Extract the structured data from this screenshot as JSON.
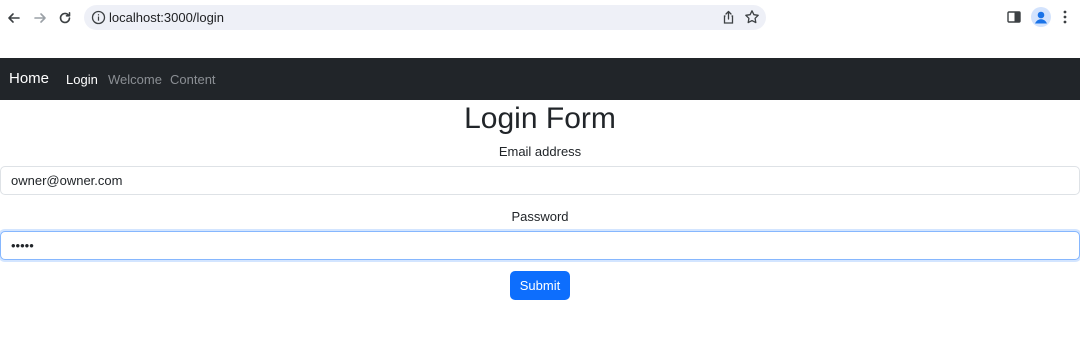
{
  "browser": {
    "url": "localhost:3000/login"
  },
  "navbar": {
    "brand": "Home",
    "links": [
      {
        "label": "Login",
        "state": "active"
      },
      {
        "label": "Welcome",
        "state": "muted"
      },
      {
        "label": "Content",
        "state": "muted"
      }
    ]
  },
  "form": {
    "title": "Login Form",
    "email_label": "Email address",
    "email_value": "owner@owner.com",
    "password_label": "Password",
    "password_value": "owner",
    "submit_label": "Submit"
  },
  "colors": {
    "navbar_bg": "#212529",
    "primary": "#0d6efd",
    "focus_border": "#86b7fe"
  },
  "icons": [
    "back-arrow-icon",
    "forward-arrow-icon",
    "reload-icon",
    "info-icon",
    "share-icon",
    "star-icon",
    "side-panel-icon",
    "profile-icon",
    "kebab-menu-icon"
  ]
}
